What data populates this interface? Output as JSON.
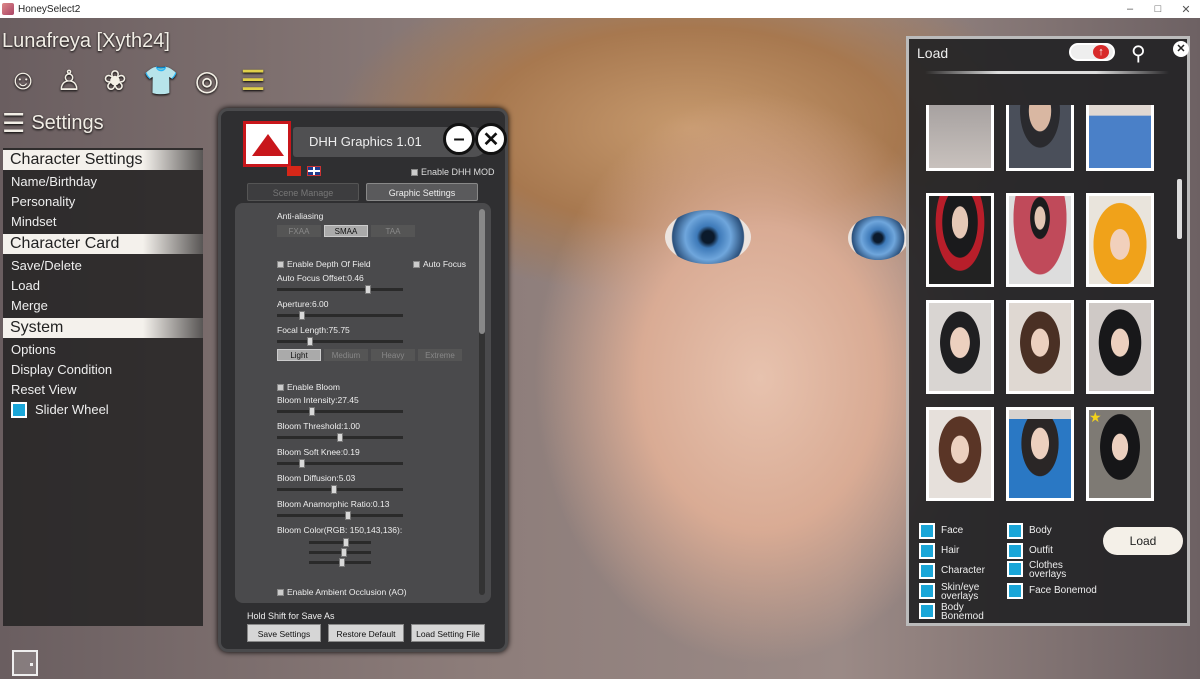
{
  "window": {
    "title": "HoneySelect2",
    "controls": [
      "–",
      "□",
      "✕"
    ]
  },
  "character": {
    "name": "Lunafreya [Xyth24]"
  },
  "topicons": [
    "face-icon",
    "body-icon",
    "hair-icon",
    "clothes-icon",
    "ring-icon",
    "list-icon"
  ],
  "settings": {
    "title": "Settings"
  },
  "leftmenu": {
    "character_settings": "Character Settings",
    "name_birthday": "Name/Birthday",
    "personality": "Personality",
    "mindset": "Mindset",
    "character_card": "Character Card",
    "save_delete": "Save/Delete",
    "load": "Load",
    "merge": "Merge",
    "system": "System",
    "options": "Options",
    "display_condition": "Display Condition",
    "reset_view": "Reset View",
    "slider_wheel": "Slider Wheel"
  },
  "dhh": {
    "title": "DHH Graphics 1.01",
    "enable_mod": "Enable DHH MOD",
    "tabs": [
      "Scene Manage",
      "Graphic Settings"
    ],
    "anti_aliasing": "Anti-aliasing",
    "aa_options": [
      "FXAA",
      "SMAA",
      "TAA"
    ],
    "enable_dof": "Enable Depth Of Field",
    "auto_focus": "Auto Focus",
    "auto_focus_offset": "Auto Focus Offset:0.46",
    "aperture": "Aperture:6.00",
    "focal_length": "Focal Length:75.75",
    "quality": [
      "Light",
      "Medium",
      "Heavy",
      "Extreme"
    ],
    "enable_bloom": "Enable Bloom",
    "bloom_intensity": "Bloom Intensity:27.45",
    "bloom_threshold": "Bloom Threshold:1.00",
    "bloom_soft_knee": "Bloom Soft Knee:0.19",
    "bloom_diffusion": "Bloom Diffusion:5.03",
    "bloom_anamorphic": "Bloom Anamorphic Ratio:0.13",
    "bloom_color": "Bloom Color(RGB: 150,143,136):",
    "enable_ao": "Enable Ambient Occlusion  (AO)",
    "hint": "Hold Shift for Save As",
    "buttons": [
      "Save Settings",
      "Restore Default",
      "Load Setting File"
    ],
    "values": {
      "auto_focus_offset": 0.46,
      "aperture": 6.0,
      "focal_length": 75.75,
      "bloom_intensity": 27.45,
      "bloom_threshold": 1.0,
      "bloom_soft_knee": 0.19,
      "bloom_diffusion": 5.03,
      "bloom_anamorphic": 0.13,
      "bloom_rgb": [
        150,
        143,
        136
      ]
    }
  },
  "load": {
    "title": "Load",
    "toggle_icon": "up-arrow-icon",
    "options": {
      "face": "Face",
      "body": "Body",
      "hair": "Hair",
      "outfit": "Outfit",
      "character": "Character",
      "clothes_overlays": "Clothes overlays",
      "skin_eye_overlays": "Skin/eye overlays",
      "face_bonemod": "Face Bonemod",
      "body_bonemod": "Body Bonemod"
    },
    "load_button": "Load"
  },
  "colors": {
    "accent": "#1aa6d8",
    "panel": "#2f2f31",
    "logo_red": "#c8161b"
  }
}
